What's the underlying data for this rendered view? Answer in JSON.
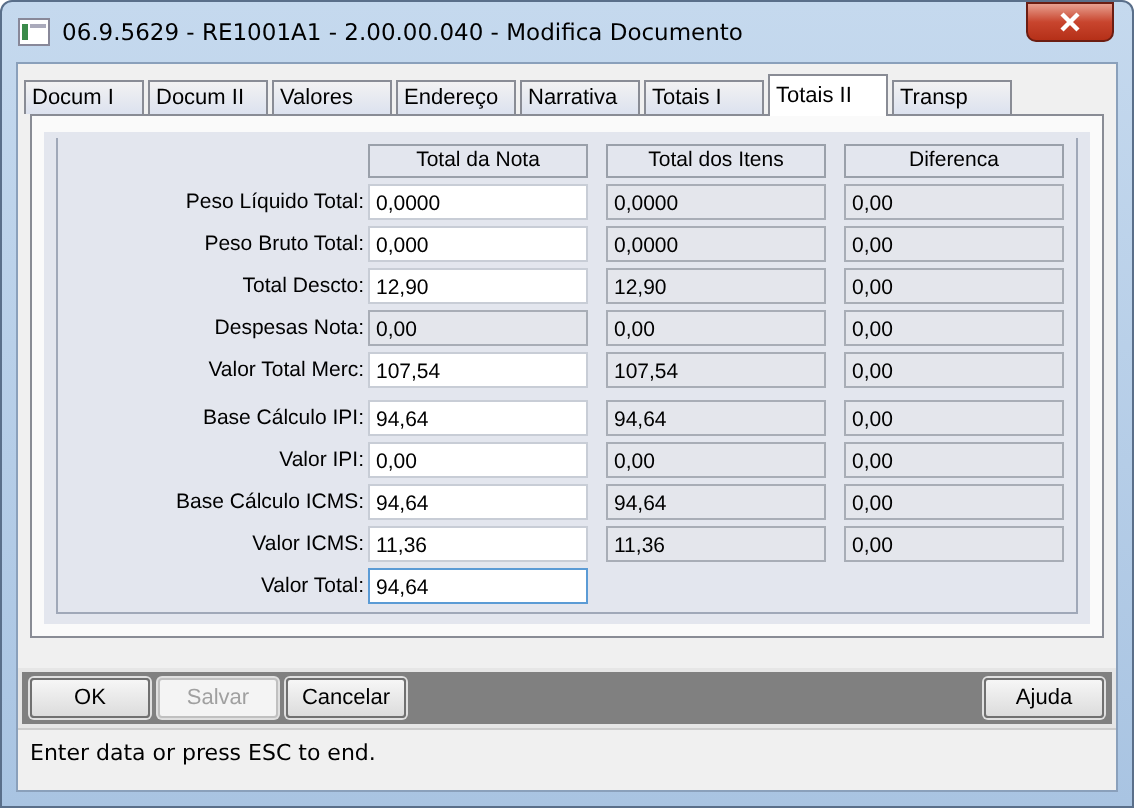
{
  "window": {
    "title": "06.9.5629 - RE1001A1 - 2.00.00.040 - Modifica Documento"
  },
  "tabs": [
    {
      "label": "Docum I",
      "selected": false
    },
    {
      "label": "Docum II",
      "selected": false
    },
    {
      "label": "Valores",
      "selected": false
    },
    {
      "label": "Endereço",
      "selected": false
    },
    {
      "label": "Narrativa",
      "selected": false
    },
    {
      "label": "Totais I",
      "selected": false
    },
    {
      "label": "Totais II",
      "selected": true
    },
    {
      "label": "Transp",
      "selected": false
    }
  ],
  "columns": [
    "Total da Nota",
    "Total dos Itens",
    "Diferenca"
  ],
  "rows": [
    {
      "label": "Peso Líquido Total:",
      "fields": [
        {
          "value": "0,0000",
          "disabled": false,
          "focused": false
        },
        {
          "value": "0,0000",
          "disabled": true,
          "focused": false
        },
        {
          "value": "0,00",
          "disabled": true,
          "focused": false
        }
      ]
    },
    {
      "label": "Peso Bruto Total:",
      "fields": [
        {
          "value": "0,000",
          "disabled": false,
          "focused": false
        },
        {
          "value": "0,0000",
          "disabled": true,
          "focused": false
        },
        {
          "value": "0,00",
          "disabled": true,
          "focused": false
        }
      ]
    },
    {
      "label": "Total Descto:",
      "fields": [
        {
          "value": "12,90",
          "disabled": false,
          "focused": false
        },
        {
          "value": "12,90",
          "disabled": true,
          "focused": false
        },
        {
          "value": "0,00",
          "disabled": true,
          "focused": false
        }
      ]
    },
    {
      "label": "Despesas Nota:",
      "fields": [
        {
          "value": "0,00",
          "disabled": true,
          "focused": false
        },
        {
          "value": "0,00",
          "disabled": true,
          "focused": false
        },
        {
          "value": "0,00",
          "disabled": true,
          "focused": false
        }
      ]
    },
    {
      "label": "Valor Total Merc:",
      "fields": [
        {
          "value": "107,54",
          "disabled": false,
          "focused": false
        },
        {
          "value": "107,54",
          "disabled": true,
          "focused": false
        },
        {
          "value": "0,00",
          "disabled": true,
          "focused": false
        }
      ]
    },
    {
      "label": "Base Cálculo IPI:",
      "fields": [
        {
          "value": "94,64",
          "disabled": false,
          "focused": false
        },
        {
          "value": "94,64",
          "disabled": true,
          "focused": false
        },
        {
          "value": "0,00",
          "disabled": true,
          "focused": false
        }
      ]
    },
    {
      "label": "Valor IPI:",
      "fields": [
        {
          "value": "0,00",
          "disabled": false,
          "focused": false
        },
        {
          "value": "0,00",
          "disabled": true,
          "focused": false
        },
        {
          "value": "0,00",
          "disabled": true,
          "focused": false
        }
      ]
    },
    {
      "label": "Base Cálculo ICMS:",
      "fields": [
        {
          "value": "94,64",
          "disabled": false,
          "focused": false
        },
        {
          "value": "94,64",
          "disabled": true,
          "focused": false
        },
        {
          "value": "0,00",
          "disabled": true,
          "focused": false
        }
      ]
    },
    {
      "label": "Valor ICMS:",
      "fields": [
        {
          "value": "11,36",
          "disabled": false,
          "focused": false
        },
        {
          "value": "11,36",
          "disabled": true,
          "focused": false
        },
        {
          "value": "0,00",
          "disabled": true,
          "focused": false
        }
      ]
    },
    {
      "label": "Valor Total:",
      "fields": [
        {
          "value": "94,64",
          "disabled": false,
          "focused": true
        }
      ]
    }
  ],
  "buttons_left": [
    {
      "label": "OK",
      "disabled": false
    },
    {
      "label": "Salvar",
      "disabled": true
    },
    {
      "label": "Cancelar",
      "disabled": false
    }
  ],
  "buttons_right": [
    {
      "label": "Ajuda",
      "disabled": false
    }
  ],
  "status_bar": "Enter data or press ESC to end."
}
